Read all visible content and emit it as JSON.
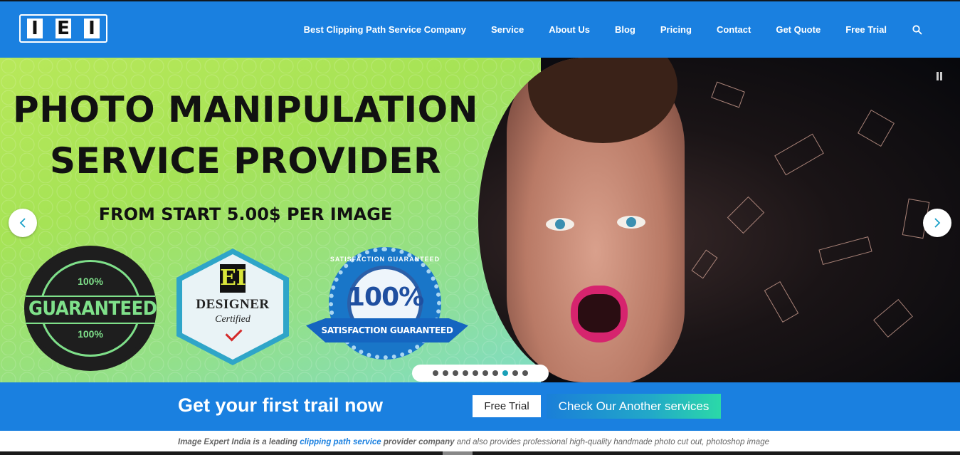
{
  "header": {
    "logo_letters": [
      "I",
      "E",
      "I"
    ],
    "nav": [
      "Best Clipping Path Service Company",
      "Service",
      "About Us",
      "Blog",
      "Pricing",
      "Contact",
      "Get Quote",
      "Free Trial"
    ],
    "search_icon": "search-icon",
    "bg_color": "#1a80e0"
  },
  "slider": {
    "title_line1": "PHOTO MANIPULATION",
    "title_line2": "SERVICE PROVIDER",
    "subtitle": "FROM START 5.00$ PER  IMAGE",
    "badge_guarantee": {
      "top": "100%",
      "main": "GUARANTEED",
      "bottom": "100%"
    },
    "badge_designer": {
      "mark": "EI",
      "title": "DESIGNER",
      "subtitle": "Certified"
    },
    "badge_satisfaction": {
      "arc": "SATISFACTION GUARANTEED",
      "percent": "100%",
      "ribbon": "SATISFACTION GUARANTEED"
    },
    "dot_count": 10,
    "active_dot": 8,
    "prev_icon": "chevron-left-icon",
    "next_icon": "chevron-right-icon",
    "pause_icon": "pause-icon"
  },
  "cta": {
    "title": "Get your first trail now",
    "free_trial": "Free Trial",
    "more_services": "Check Our Another services"
  },
  "intro": {
    "part1": "Image Expert India is a leading ",
    "link1": "clipping path service",
    "part2": " provider company",
    "part3": " and also provides professional high-quality handmade ",
    "part4": "photo cut out, photoshop image"
  }
}
